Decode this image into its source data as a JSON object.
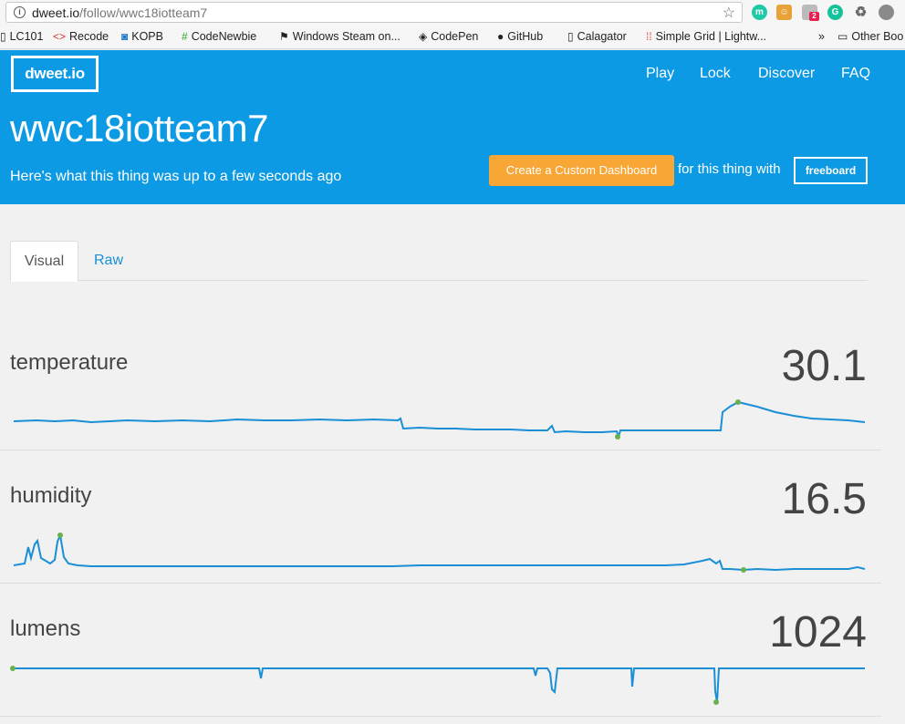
{
  "browser": {
    "url_host": "dweet.io",
    "url_path": "/follow/wwc18iotteam7",
    "bookmarks": [
      {
        "label": "LC101",
        "icon": "page-icon"
      },
      {
        "label": "Recode",
        "icon": "code-icon"
      },
      {
        "label": "KOPB",
        "icon": "kopb-icon"
      },
      {
        "label": "CodeNewbie",
        "icon": "hash-icon"
      },
      {
        "label": "Windows Steam on...",
        "icon": "flag-icon"
      },
      {
        "label": "CodePen",
        "icon": "codepen-icon"
      },
      {
        "label": "GitHub",
        "icon": "github-icon"
      },
      {
        "label": "Calagator",
        "icon": "page-icon"
      },
      {
        "label": "Simple Grid | Lightw...",
        "icon": "grid-icon"
      }
    ],
    "overflow": "»",
    "other_bookmarks": "Other Boo",
    "extension_badge": "2"
  },
  "header": {
    "logo": "dweet.io",
    "nav": [
      "Play",
      "Lock",
      "Discover",
      "FAQ"
    ],
    "thing_name": "wwc18iotteam7",
    "subtitle": "Here's what this thing was up to a few seconds ago",
    "cta_button": "Create a Custom Dashboard",
    "cta_tail": "for this thing with",
    "freeboard_button": "freeboard"
  },
  "tabs": [
    {
      "label": "Visual",
      "active": true
    },
    {
      "label": "Raw",
      "active": false
    }
  ],
  "colors": {
    "header_blue": "#0c9ae4",
    "cta_orange": "#f8a635",
    "line_blue": "#1a8fd6",
    "marker_green": "#6ab04c"
  },
  "metrics": [
    {
      "name": "temperature",
      "value": "30.1"
    },
    {
      "name": "humidity",
      "value": "16.5"
    },
    {
      "name": "lumens",
      "value": "1024"
    }
  ]
}
